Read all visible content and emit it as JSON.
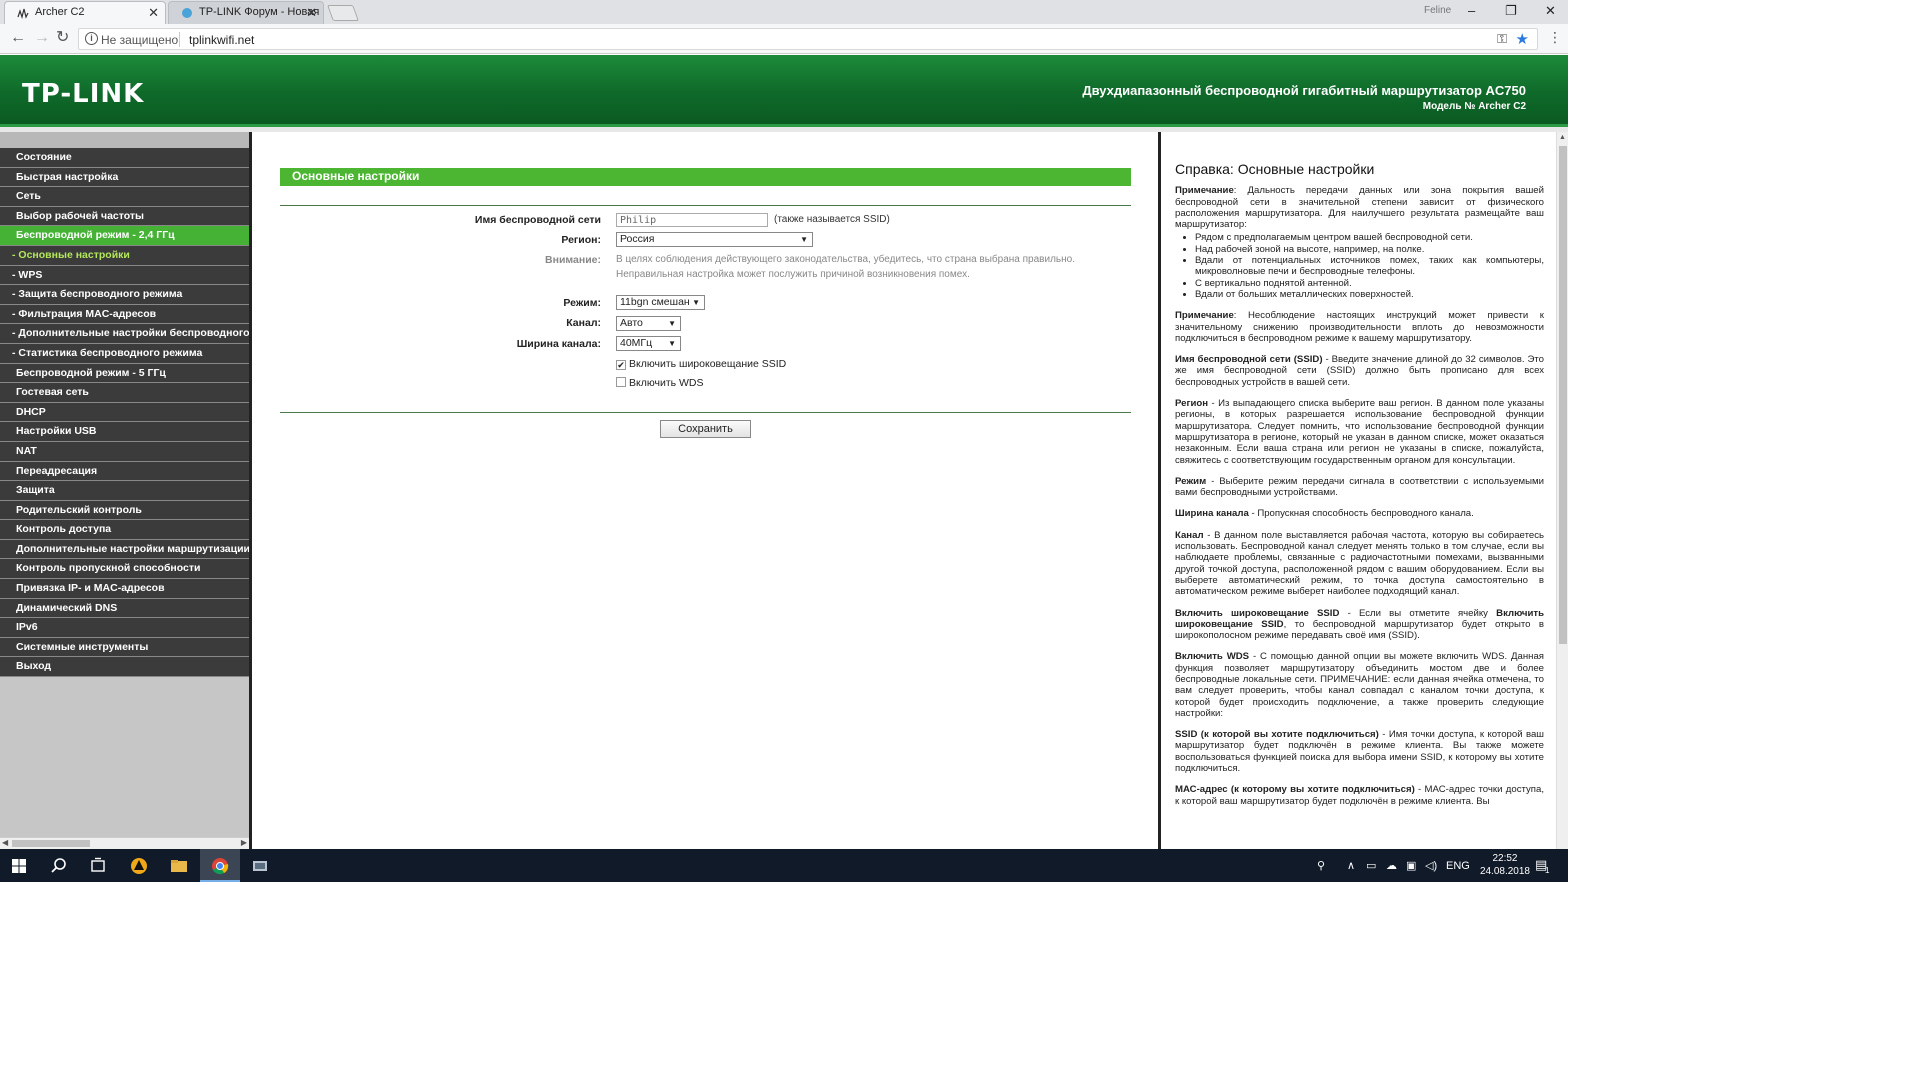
{
  "browser": {
    "tabs": [
      {
        "title": "Archer C2",
        "active": true
      },
      {
        "title": "TP-LINK Форум - Новая",
        "active": false
      }
    ],
    "profile": "Feline",
    "window_controls": {
      "minimize": "–",
      "restore": "❐",
      "close": "✕"
    },
    "security_label": "Не защищено",
    "url": "tplinkwifi.net"
  },
  "header": {
    "logo": "TP-LINK",
    "title": "Двухдиапазонный беспроводной гигабитный маршрутизатор AC750",
    "model": "Модель № Archer C2",
    "colors": {
      "banner": "#0f6a2a",
      "accent_green": "#4cb632"
    }
  },
  "sidebar": {
    "items": [
      {
        "label": "Состояние",
        "sub": false,
        "state": ""
      },
      {
        "label": "Быстрая настройка",
        "sub": false,
        "state": ""
      },
      {
        "label": "Сеть",
        "sub": false,
        "state": ""
      },
      {
        "label": "Выбор рабочей частоты",
        "sub": false,
        "state": ""
      },
      {
        "label": "Беспроводной режим - 2,4 ГГц",
        "sub": false,
        "state": "active-parent"
      },
      {
        "label": "- Основные настройки",
        "sub": true,
        "state": "active"
      },
      {
        "label": "- WPS",
        "sub": true,
        "state": ""
      },
      {
        "label": "- Защита беспроводного режима",
        "sub": true,
        "state": ""
      },
      {
        "label": "- Фильтрация MAC-адресов",
        "sub": true,
        "state": ""
      },
      {
        "label": "- Дополнительные настройки беспроводного",
        "sub": true,
        "state": ""
      },
      {
        "label": "- Статистика беспроводного режима",
        "sub": true,
        "state": ""
      },
      {
        "label": "Беспроводной режим - 5 ГГц",
        "sub": false,
        "state": ""
      },
      {
        "label": "Гостевая сеть",
        "sub": false,
        "state": ""
      },
      {
        "label": "DHCP",
        "sub": false,
        "state": ""
      },
      {
        "label": "Настройки USB",
        "sub": false,
        "state": ""
      },
      {
        "label": "NAT",
        "sub": false,
        "state": ""
      },
      {
        "label": "Переадресация",
        "sub": false,
        "state": ""
      },
      {
        "label": "Защита",
        "sub": false,
        "state": ""
      },
      {
        "label": "Родительский контроль",
        "sub": false,
        "state": ""
      },
      {
        "label": "Контроль доступа",
        "sub": false,
        "state": ""
      },
      {
        "label": "Дополнительные настройки маршрутизации",
        "sub": false,
        "state": ""
      },
      {
        "label": "Контроль пропускной способности",
        "sub": false,
        "state": ""
      },
      {
        "label": "Привязка IP- и MAC-адресов",
        "sub": false,
        "state": ""
      },
      {
        "label": "Динамический DNS",
        "sub": false,
        "state": ""
      },
      {
        "label": "IPv6",
        "sub": false,
        "state": ""
      },
      {
        "label": "Системные инструменты",
        "sub": false,
        "state": ""
      },
      {
        "label": "Выход",
        "sub": false,
        "state": ""
      }
    ]
  },
  "main": {
    "section_title": "Основные настройки",
    "ssid_label": "Имя беспроводной сети",
    "ssid_value": "Philip",
    "ssid_hint": "(также называется SSID)",
    "region_label": "Регион:",
    "region_value": "Россия",
    "warning_label": "Внимание:",
    "warning_line1": "В целях соблюдения действующего законодательства, убедитесь, что страна выбрана правильно.",
    "warning_line2": "Неправильная настройка может послужить причиной возникновения помех.",
    "mode_label": "Режим:",
    "mode_value": "11bgn смешан",
    "channel_label": "Канал:",
    "channel_value": "Авто",
    "width_label": "Ширина канала:",
    "width_value": "40МГц",
    "ssid_broadcast_label": "Включить широковещание SSID",
    "ssid_broadcast_checked": true,
    "wds_label": "Включить WDS",
    "wds_checked": false,
    "save_label": "Сохранить"
  },
  "help": {
    "title": "Справка: Основные настройки",
    "note1_head": "Примечание",
    "note1_text": ": Дальность передачи данных или зона покрытия вашей беспроводной сети в значительной степени зависит от физического расположения маршрутизатора. Для наилучшего результата размещайте ваш маршрутизатор:",
    "tips": [
      "Рядом с предполагаемым центром вашей беспроводной сети.",
      "Над рабочей зоной на высоте, например, на полке.",
      "Вдали от потенциальных источников помех, таких как компьютеры, микроволновые печи и беспроводные телефоны.",
      "С вертикально поднятой антенной.",
      "Вдали от больших металлических поверхностей."
    ],
    "note2_head": "Примечание",
    "note2_text": ": Несоблюдение настоящих инструкций может привести к значительному снижению производительности вплоть до невозможности подключиться в беспроводном режиме к вашему маршрутизатору.",
    "ssid_head": "Имя беспроводной сети (SSID)",
    "ssid_text": " - Введите значение длиной до 32 символов. Это же имя беспроводной сети (SSID) должно быть прописано для всех беспроводных устройств в вашей сети.",
    "region_head": "Регион",
    "region_text": " - Из выпадающего списка выберите ваш регион. В данном поле указаны регионы, в которых разрешается использование беспроводной функции маршрутизатора. Следует помнить, что использование беспроводной функции маршрутизатора в регионе, который не указан в данном списке, может оказаться незаконным. Если ваша страна или регион не указаны в списке, пожалуйста, свяжитесь с соответствующим государственным органом для консультации.",
    "mode_head": "Режим",
    "mode_text": " - Выберите режим передачи сигнала в соответствии с используемыми вами беспроводными устройствами.",
    "width_head": "Ширина канала",
    "width_text": " - Пропускная способность беспроводного канала.",
    "channel_head": "Канал",
    "channel_text": " - В данном поле выставляется рабочая частота, которую вы собираетесь использовать. Беспроводной канал следует менять только в том случае, если вы наблюдаете проблемы, связанные с радиочастотными помехами, вызванными другой точкой доступа, расположенной рядом с вашим оборудованием. Если вы выберете автоматический режим, то точка доступа самостоятельно в автоматическом режиме выберет наиболее подходящий канал.",
    "bcast_head": "Включить широковещание SSID",
    "bcast_text1": " - Если вы отметите ячейку ",
    "bcast_head2": "Включить широковещание SSID",
    "bcast_text2": ", то беспроводной маршрутизатор будет открыто в широкополосном режиме передавать своё имя (SSID).",
    "wds_head": "Включить WDS",
    "wds_text": " - С помощью данной опции вы можете включить WDS. Данная функция позволяет маршрутизатору объединить мостом две и более беспроводные локальные сети. ПРИМЕЧАНИЕ: если данная ячейка отмечена, то вам следует проверить, чтобы канал совпадал с каналом точки доступа, к которой будет происходить подключение, а также проверить следующие настройки:",
    "wssid_head": "SSID (к которой вы хотите подключиться)",
    "wssid_text": " - Имя точки доступа, к которой ваш маршрутизатор будет подключён в режиме клиента. Вы также можете воспользоваться функцией поиска для выбора имени SSID, к которому вы хотите подключиться.",
    "mac_head": "МАС-адрес (к которому вы хотите подключиться)",
    "mac_text": " - МАС-адрес точки доступа, к которой ваш маршрутизатор будет подключён в режиме клиента. Вы"
  },
  "taskbar": {
    "lang": "ENG",
    "time": "22:52",
    "date": "24.08.2018",
    "notification_count": "1"
  }
}
